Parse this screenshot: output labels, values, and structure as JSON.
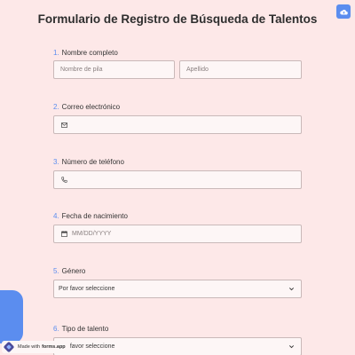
{
  "form": {
    "title": "Formulario de Registro de Búsqueda de Talentos"
  },
  "questions": [
    {
      "number": "1.",
      "label": "Nombre completo",
      "first_placeholder": "Nombre de pila",
      "last_placeholder": "Apellido"
    },
    {
      "number": "2.",
      "label": "Correo electrónico",
      "icon": "mail-icon"
    },
    {
      "number": "3.",
      "label": "Número de teléfono",
      "icon": "phone-icon"
    },
    {
      "number": "4.",
      "label": "Fecha de nacimiento",
      "icon": "calendar-icon",
      "placeholder": "MM/DD/YYYY"
    },
    {
      "number": "5.",
      "label": "Género",
      "selected": "Por favor seleccione"
    },
    {
      "number": "6.",
      "label": "Tipo de talento",
      "selected": "Por favor seleccione"
    }
  ],
  "badge": {
    "made_with": "Made with",
    "brand": "forms.app"
  },
  "colors": {
    "background": "#fde8e8",
    "accent": "#5b8def",
    "field_bg": "#fdf6f6",
    "field_border": "#c9b9b9"
  }
}
